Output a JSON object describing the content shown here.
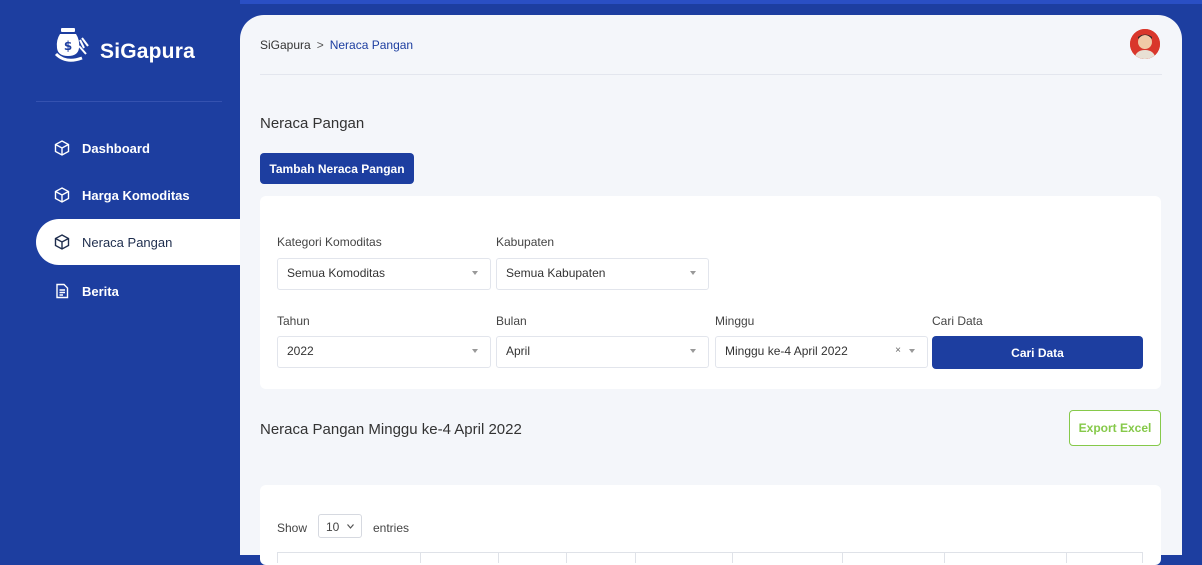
{
  "app": {
    "name": "SiGapura"
  },
  "sidebar": {
    "items": [
      {
        "label": "Dashboard",
        "icon": "cube-icon"
      },
      {
        "label": "Harga Komoditas",
        "icon": "cube-icon"
      },
      {
        "label": "Neraca Pangan",
        "icon": "cube-icon",
        "active": true
      },
      {
        "label": "Berita",
        "icon": "document-icon"
      }
    ]
  },
  "breadcrumb": {
    "root": "SiGapura",
    "separator": ">",
    "current": "Neraca Pangan"
  },
  "page": {
    "title": "Neraca Pangan",
    "add_button": "Tambah Neraca Pangan"
  },
  "filters": {
    "kategori": {
      "label": "Kategori Komoditas",
      "value": "Semua Komoditas"
    },
    "kabupaten": {
      "label": "Kabupaten",
      "value": "Semua Kabupaten"
    },
    "tahun": {
      "label": "Tahun",
      "value": "2022"
    },
    "bulan": {
      "label": "Bulan",
      "value": "April"
    },
    "minggu": {
      "label": "Minggu",
      "value": "Minggu ke-4 April 2022",
      "clear": "×"
    },
    "cari": {
      "label": "Cari Data",
      "button": "Cari Data"
    }
  },
  "results": {
    "title": "Neraca Pangan Minggu ke-4 April 2022",
    "export_button": "Export Excel"
  },
  "table": {
    "show_label": "Show",
    "length_value": "10",
    "entries_label": "entries"
  },
  "colors": {
    "primary": "#1d3ea0",
    "accent_green": "#86c94a",
    "background": "#f4f6fa"
  }
}
